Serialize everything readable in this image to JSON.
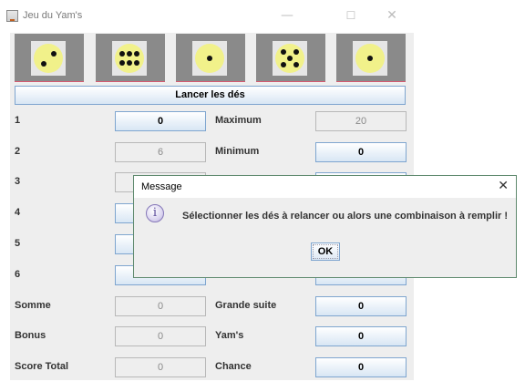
{
  "window": {
    "title": "Jeu du Yam's",
    "controls": {
      "minimize": "—",
      "maximize": "☐",
      "close": "✕"
    }
  },
  "dice": [
    {
      "face": 2
    },
    {
      "face": 6
    },
    {
      "face": 1
    },
    {
      "face": 5
    },
    {
      "face": 1
    }
  ],
  "roll_button": {
    "label": "Lancer les dés"
  },
  "score_rows": [
    {
      "label": "1",
      "value": "0",
      "enabled": true,
      "right_label": "Maximum",
      "right_value": "20",
      "right_enabled": false
    },
    {
      "label": "2",
      "value": "6",
      "enabled": false,
      "right_label": "Minimum",
      "right_value": "0",
      "right_enabled": true
    },
    {
      "label": "3",
      "value": "",
      "enabled": false,
      "right_label": "",
      "right_value": "",
      "right_enabled": true
    },
    {
      "label": "4",
      "value": "",
      "enabled": true,
      "right_label": "",
      "right_value": "",
      "right_enabled": true
    },
    {
      "label": "5",
      "value": "",
      "enabled": true,
      "right_label": "",
      "right_value": "",
      "right_enabled": true
    },
    {
      "label": "6",
      "value": "",
      "enabled": true,
      "right_label": "",
      "right_value": "",
      "right_enabled": true
    },
    {
      "label": "Somme",
      "value": "0",
      "enabled": false,
      "right_label": "Grande suite",
      "right_value": "0",
      "right_enabled": true
    },
    {
      "label": "Bonus",
      "value": "0",
      "enabled": false,
      "right_label": "Yam's",
      "right_value": "0",
      "right_enabled": true
    },
    {
      "label": "Score Total",
      "value": "0",
      "enabled": false,
      "right_label": "Chance",
      "right_value": "0",
      "right_enabled": true
    }
  ],
  "dialog": {
    "title": "Message",
    "close": "✕",
    "icon": "info-icon",
    "icon_glyph": "i",
    "message": "Sélectionner les dés à relancer ou alors une combinaison à remplir !",
    "ok_label": "OK"
  }
}
